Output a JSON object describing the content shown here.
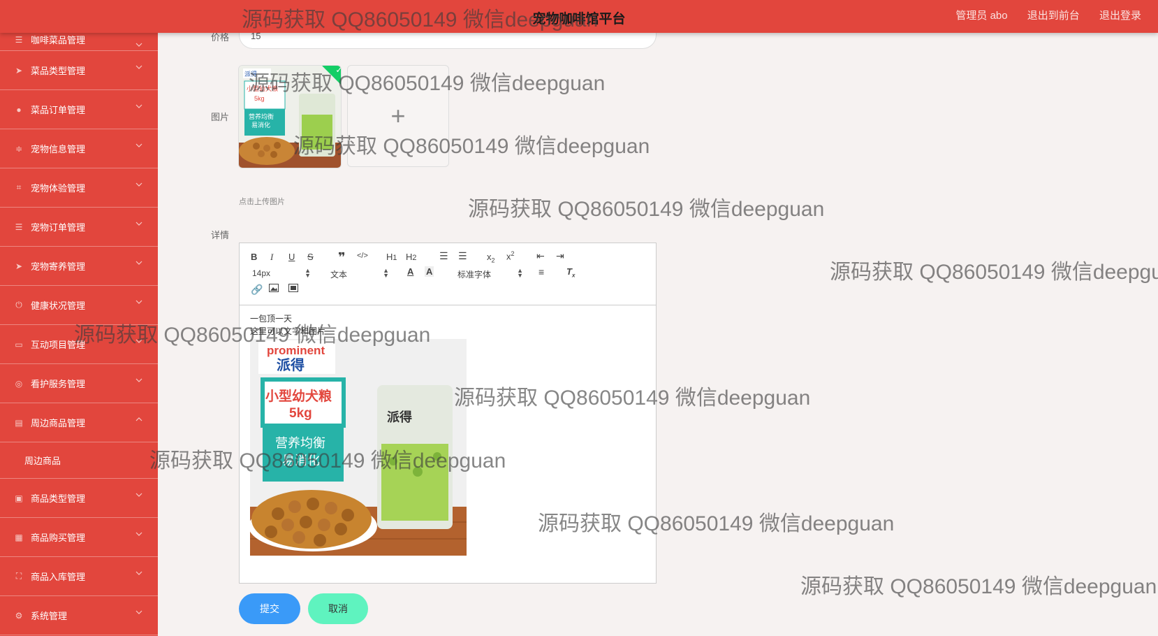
{
  "header": {
    "title": "宠物咖啡馆平台",
    "user_label": "管理员 abo",
    "back_to_front_label": "退出到前台",
    "logout_label": "退出登录"
  },
  "sidebar": {
    "items": [
      {
        "label": "咖啡菜品管理",
        "icon": "list-icon"
      },
      {
        "label": "菜品类型管理",
        "icon": "send-icon"
      },
      {
        "label": "菜品订单管理",
        "icon": "user-icon"
      },
      {
        "label": "宠物信息管理",
        "icon": "sliders-icon"
      },
      {
        "label": "宠物体验管理",
        "icon": "crop-icon"
      },
      {
        "label": "宠物订单管理",
        "icon": "list-icon"
      },
      {
        "label": "宠物寄养管理",
        "icon": "send-icon"
      },
      {
        "label": "健康状况管理",
        "icon": "power-icon"
      },
      {
        "label": "互动项目管理",
        "icon": "monitor-icon"
      },
      {
        "label": "看护服务管理",
        "icon": "compass-icon"
      },
      {
        "label": "周边商品管理",
        "icon": "chat-icon",
        "expanded": true
      },
      {
        "label": "商品类型管理",
        "icon": "message-icon"
      },
      {
        "label": "商品购买管理",
        "icon": "grid-icon"
      },
      {
        "label": "商品入库管理",
        "icon": "fullscreen-icon"
      },
      {
        "label": "系统管理",
        "icon": "settings-icon"
      }
    ],
    "submenu_label": "周边商品"
  },
  "form": {
    "price_label": "价格",
    "price_value": "15",
    "image_label": "图片",
    "upload_hint": "点击上传图片",
    "detail_label": "详情",
    "editor": {
      "font_size": "14px",
      "block_type": "文本",
      "font_family": "标准字体",
      "content_lines": [
        "一包顶一天",
        "这里可以文字和图片"
      ]
    },
    "submit_label": "提交",
    "cancel_label": "取消"
  },
  "product_image_text": {
    "brand_en": "prominent",
    "brand_cn": "派得",
    "product": "小型幼犬粮",
    "weight": "5kg",
    "tagline_1": "营养均衡",
    "tagline_2": "易消化"
  },
  "watermark": "源码获取 QQ86050149 微信deepguan",
  "colors": {
    "primary_red": "#e2463d",
    "submit_blue": "#3a9af8",
    "cancel_mint": "#5ff3bf",
    "success_green": "#13ce66"
  }
}
